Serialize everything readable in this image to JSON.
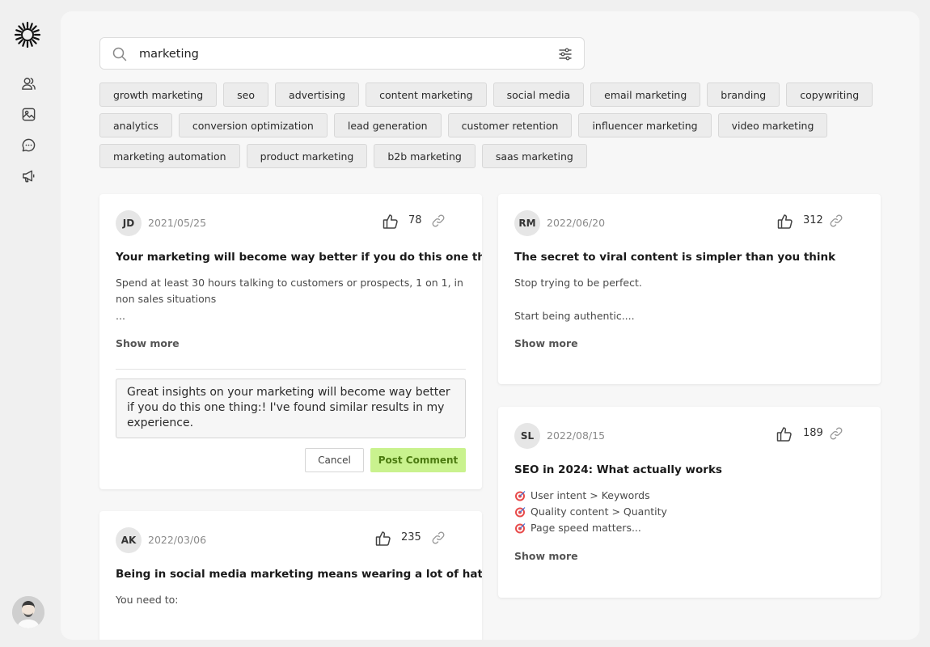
{
  "search": {
    "value": "marketing"
  },
  "tags": [
    [
      "growth marketing",
      "seo",
      "advertising",
      "content marketing",
      "social media",
      "email marketing",
      "branding",
      "copywriting"
    ],
    [
      "analytics",
      "conversion optimization",
      "lead generation",
      "customer retention",
      "influencer marketing",
      "video marketing"
    ],
    [
      "marketing automation",
      "product marketing",
      "b2b marketing",
      "saas marketing"
    ]
  ],
  "posts": {
    "p1": {
      "initials": "JD",
      "date": "2021/05/25",
      "likes": "78",
      "title": "Your marketing will become way better if you do this one thing:",
      "body1": "Spend at least 30 hours talking to customers or prospects, 1 on 1, in non sales situations",
      "body2": "...",
      "show_more": "Show more",
      "comment_value": "Great insights on your marketing will become way better if you do this one thing:! I've found similar results in my experience.",
      "cancel_label": "Cancel",
      "post_label": "Post Comment"
    },
    "p2": {
      "initials": "RM",
      "date": "2022/06/20",
      "likes": "312",
      "title": "The secret to viral content is simpler than you think",
      "body1": "Stop trying to be perfect.",
      "body2": "Start being authentic....",
      "show_more": "Show more"
    },
    "p3": {
      "initials": "SL",
      "date": "2022/08/15",
      "likes": "189",
      "title": "SEO in 2024: What actually works",
      "lines": [
        "User intent > Keywords",
        "Quality content > Quantity",
        "Page speed matters..."
      ],
      "show_more": "Show more"
    },
    "p4": {
      "initials": "AK",
      "date": "2022/03/06",
      "likes": "235",
      "title": "Being in social media marketing means wearing a lot of hats ...",
      "body1": "You need to:"
    }
  },
  "colors": {
    "accent": "#c9f28e",
    "accent_text": "#4b7a10",
    "background": "#f0f0f0",
    "panel": "#f7f7f7"
  }
}
